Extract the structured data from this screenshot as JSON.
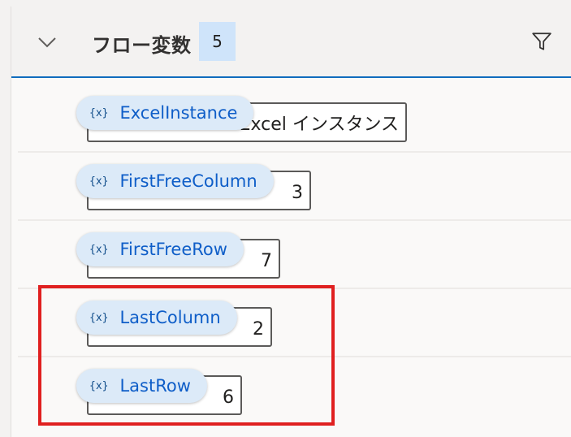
{
  "header": {
    "title": "フロー変数",
    "count": "5",
    "collapse_icon": "chevron-down-icon",
    "filter_icon": "filter-icon"
  },
  "variables": [
    {
      "icon_text": "{x}",
      "name": "ExcelInstance",
      "value": "Excel インスタンス"
    },
    {
      "icon_text": "{x}",
      "name": "FirstFreeColumn",
      "value": "3"
    },
    {
      "icon_text": "{x}",
      "name": "FirstFreeRow",
      "value": "7"
    },
    {
      "icon_text": "{x}",
      "name": "LastColumn",
      "value": "2"
    },
    {
      "icon_text": "{x}",
      "name": "LastRow",
      "value": "6"
    }
  ],
  "colors": {
    "accent": "#0f6cbd",
    "highlight": "#e02020",
    "pill": "#dceaf8",
    "variable_text": "#0f5ec8"
  }
}
